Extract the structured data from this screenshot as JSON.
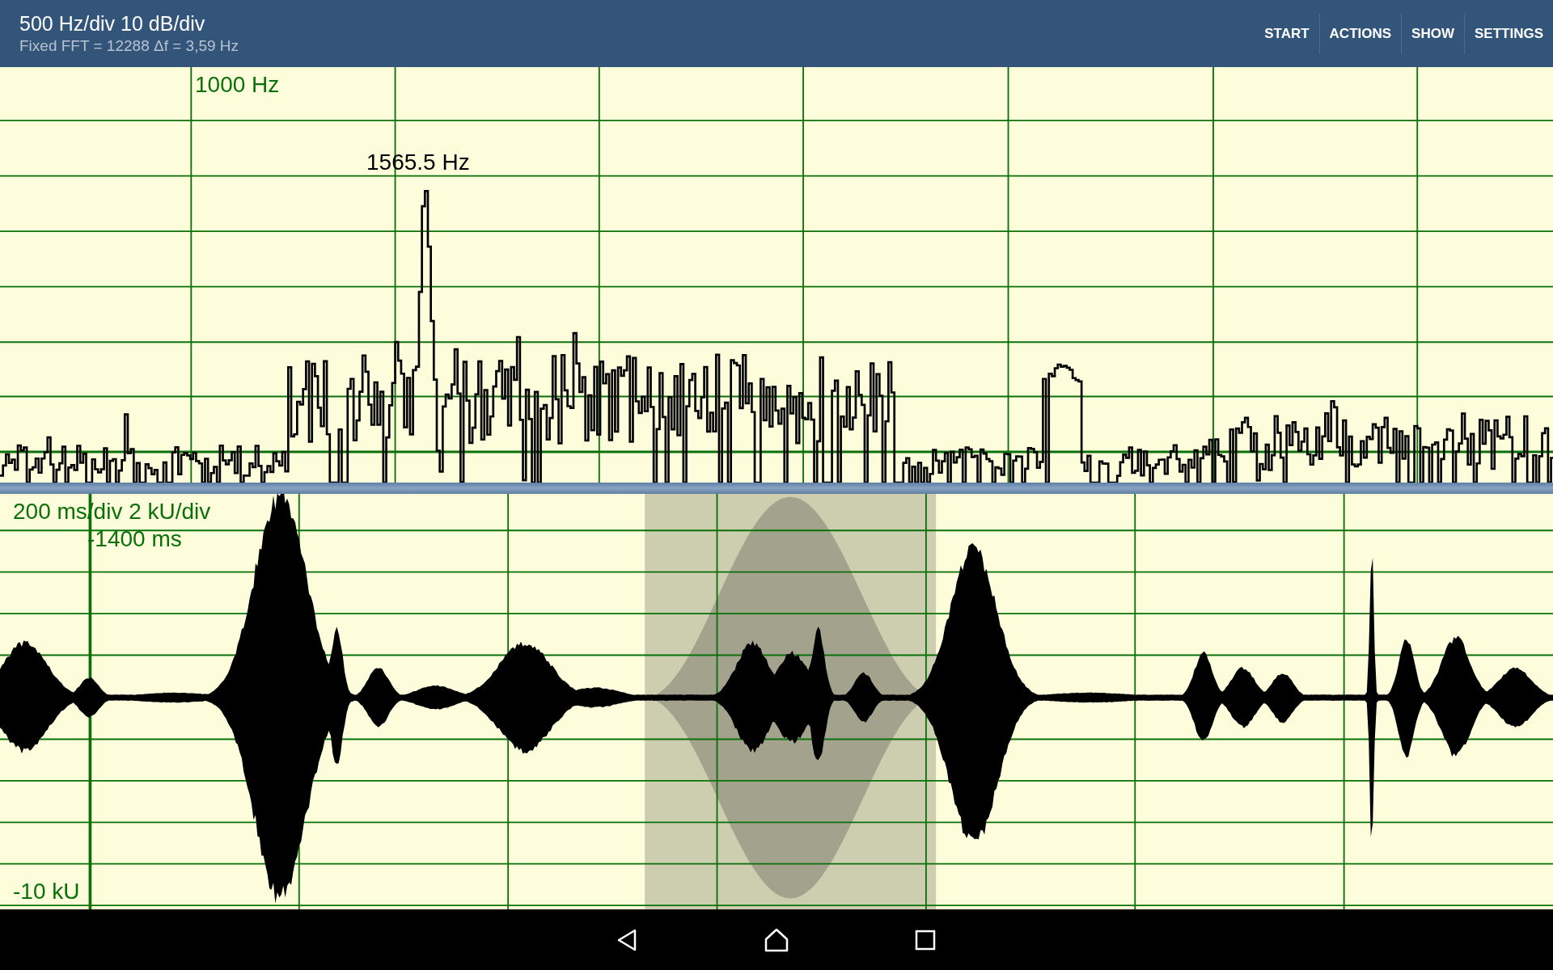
{
  "header": {
    "title": "500 Hz/div 10 dB/div",
    "subtitle": "Fixed FFT = 12288 Δf = 3,59 Hz"
  },
  "menu": [
    {
      "label": "START"
    },
    {
      "label": "ACTIONS"
    },
    {
      "label": "SHOW"
    },
    {
      "label": "SETTINGS"
    }
  ],
  "spectrum": {
    "marker_label": "1000 Hz",
    "peak_label": "1565.5 Hz"
  },
  "waveform": {
    "scale_label": "200 ms/div 2 kU/div",
    "time_label": "-1400 ms",
    "amplitude_label": "-10 kU"
  }
}
